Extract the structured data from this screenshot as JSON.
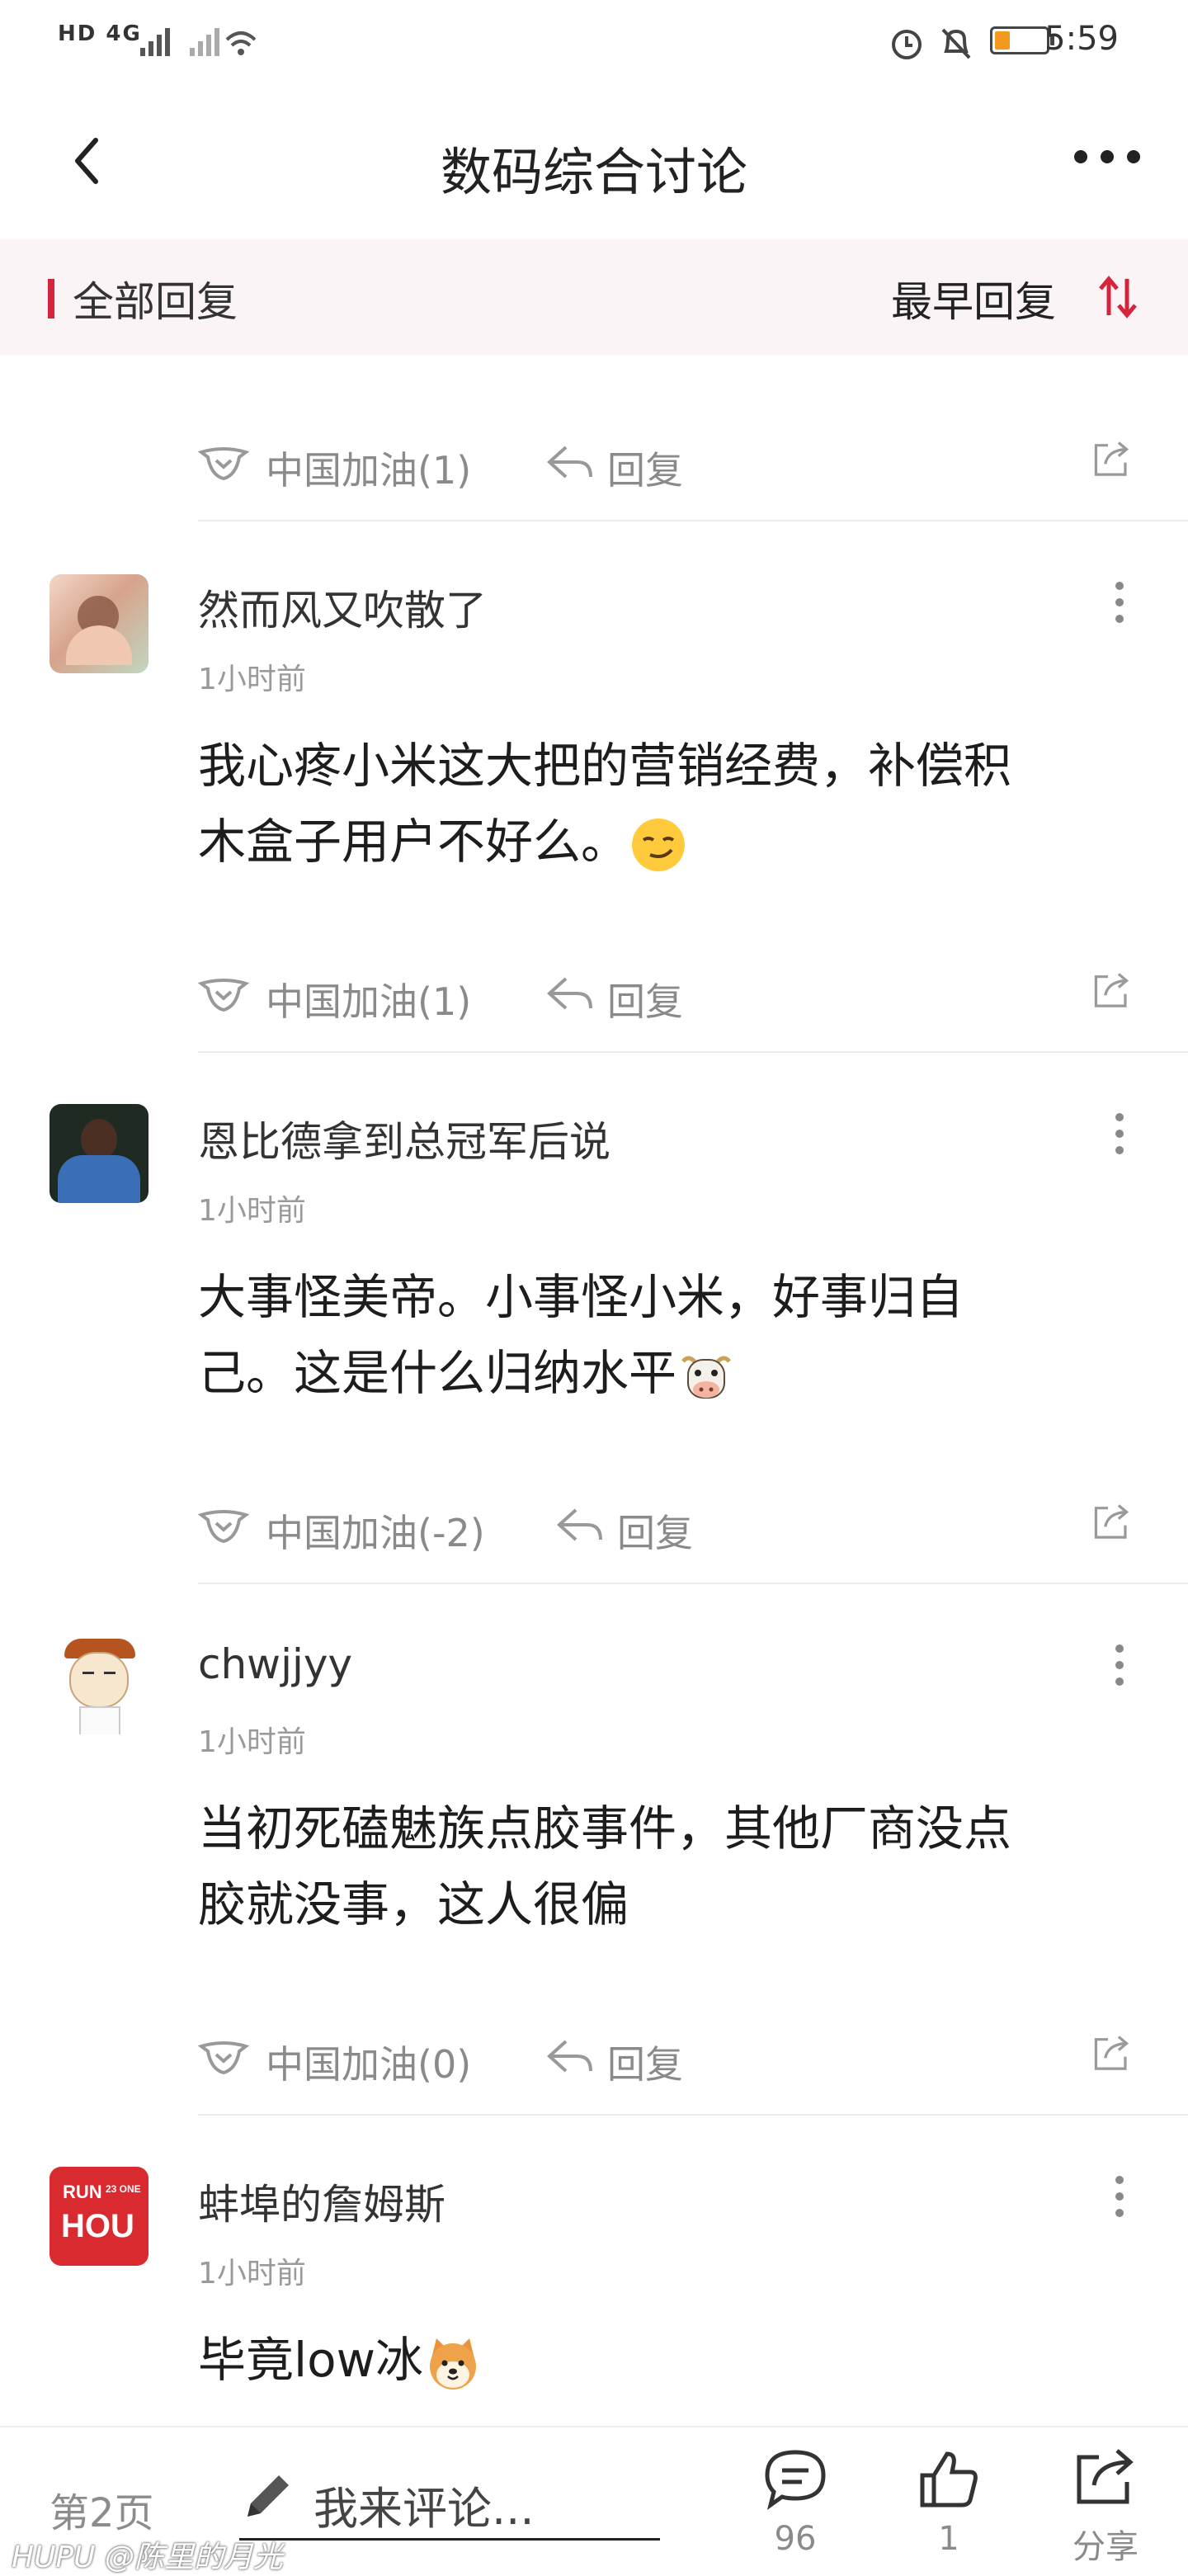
{
  "status_bar": {
    "network": "HD 4G",
    "time": "5:59",
    "battery_level": 0.2,
    "battery_color": "#f39a1e"
  },
  "header": {
    "title": "数码综合讨论"
  },
  "sort_bar": {
    "all_replies": "全部回复",
    "order": "最早回复",
    "accent": "#d6243d"
  },
  "top_actions": {
    "cheer": "中国加油(1)",
    "reply": "回复"
  },
  "comments": [
    {
      "user": "然而风又吹散了",
      "time": "1小时前",
      "line1": "我心疼小米这大把的营销经费，补偿积",
      "line2": "木盒子用户不好么。",
      "emoji": "smirk-emoji",
      "cheer": "中国加油(1)",
      "reply": "回复"
    },
    {
      "user": "恩比德拿到总冠军后说",
      "time": "1小时前",
      "line1": "大事怪美帝。小事怪小米，好事归自",
      "line2": "己。这是什么归纳水平",
      "emoji": "cow-emoji",
      "cheer": "中国加油(-2)",
      "reply": "回复"
    },
    {
      "user": "chwjjyy",
      "time": "1小时前",
      "line1": "当初死磕魅族点胶事件，其他厂商没点",
      "line2": "胶就没事，这人很偏",
      "cheer": "中国加油(0)",
      "reply": "回复"
    },
    {
      "user": "蚌埠的詹姆斯",
      "time": "1小时前",
      "line1": "毕竟low冰",
      "emoji": "shiba-dog-emoji",
      "avatar_text_top": "RUN",
      "avatar_text_side": "23 ONE",
      "avatar_text_main": "HOU"
    }
  ],
  "bottom_bar": {
    "page": "第2页",
    "comment_placeholder": "我来评论...",
    "comment_count": "96",
    "like_count": "1",
    "share_label": "分享"
  },
  "watermark": "HUPU @陈里的月光"
}
